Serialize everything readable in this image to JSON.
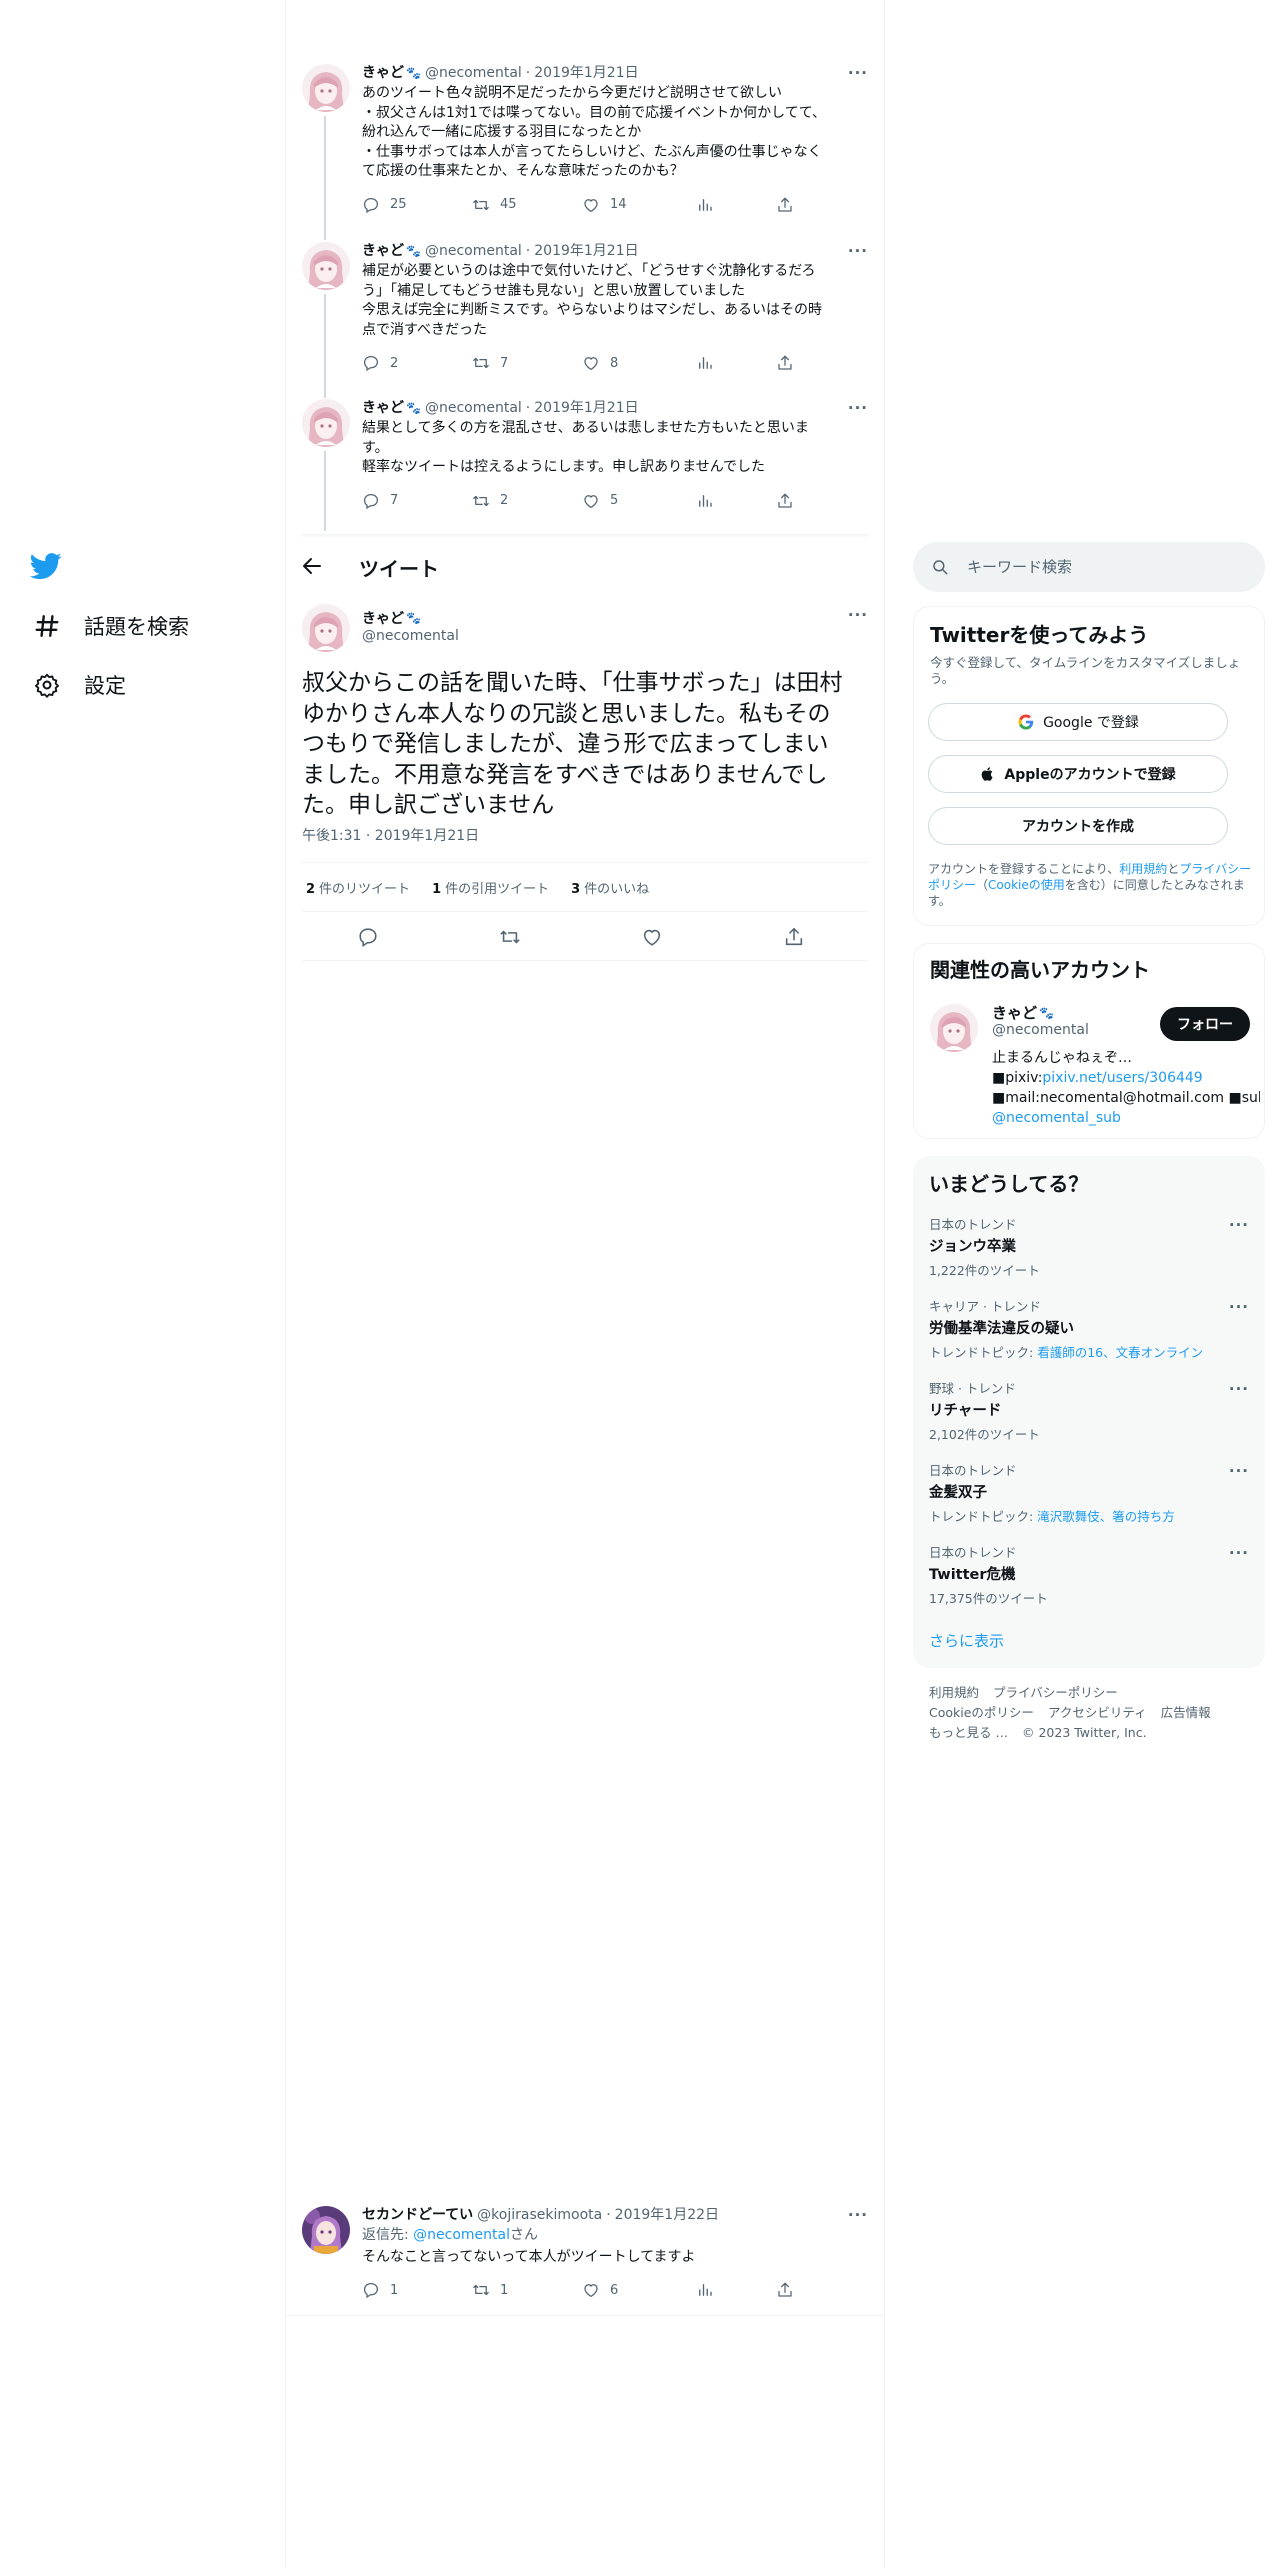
{
  "nav": {
    "items": [
      {
        "label": "話題を検索"
      },
      {
        "label": "設定"
      }
    ]
  },
  "thread": [
    {
      "name": "きゃど",
      "handle": "@necomental",
      "date": "2019年1月21日",
      "lines": [
        "あのツイート色々説明不足だったから今更だけど説明させて欲しい",
        "・叔父さんは1対1では喋ってない。目の前で応援イベントか何かしてて、",
        "紛れ込んで一緒に応援する羽目になったとか",
        "・仕事サボっては本人が言ってたらしいけど、たぶん声優の仕事じゃなく",
        "て応援の仕事来たとか、そんな意味だったのかも？"
      ],
      "replies": "25",
      "retweets": "45",
      "likes": "14"
    },
    {
      "name": "きゃど",
      "handle": "@necomental",
      "date": "2019年1月21日",
      "lines": [
        "補足が必要というのは途中で気付いたけど、「どうせすぐ沈静化するだろ",
        "う」「補足してもどうせ誰も見ない」と思い放置していました",
        "今思えば完全に判断ミスです。やらないよりはマシだし、あるいはその時",
        "点で消すべきだった"
      ],
      "replies": "2",
      "retweets": "7",
      "likes": "8"
    },
    {
      "name": "きゃど",
      "handle": "@necomental",
      "date": "2019年1月21日",
      "lines": [
        "結果として多くの方を混乱させ、あるいは悲しませた方もいたと思いま",
        "す。",
        "軽率なツイートは控えるようにします。申し訳ありませんでした"
      ],
      "replies": "7",
      "retweets": "2",
      "likes": "5"
    }
  ],
  "header": {
    "title": "ツイート"
  },
  "main_tweet": {
    "name": "きゃど",
    "handle": "@necomental",
    "lines": [
      "叔父からこの話を聞いた時、「仕事サボった」は田村",
      "ゆかりさん本人なりの冗談と思いました。私もその",
      "つもりで発信しましたが、違う形で広まってしまい",
      "ました。不用意な発言をすべきではありませんでし",
      "た。申し訳ございません"
    ],
    "time": "午後1:31 · 2019年1月21日",
    "stats": {
      "retweets_count": "2",
      "retweets_label": "件のリツイート",
      "quotes_count": "1",
      "quotes_label": "件の引用ツイート",
      "likes_count": "3",
      "likes_label": "件のいいね"
    }
  },
  "reply_tweet": {
    "name": "セカンドどーてい",
    "handle": "@kojirasekimoota",
    "date": "2019年1月22日",
    "reply_to_prefix": "返信先: ",
    "reply_to_handle": "@necomental",
    "reply_to_suffix": "さん",
    "text": "そんなこと言ってないって本人がツイートしてますよ",
    "replies": "1",
    "retweets": "1",
    "likes": "6"
  },
  "search": {
    "placeholder": "キーワード検索"
  },
  "signup": {
    "title": "Twitterを使ってみよう",
    "subtitle": "今すぐ登録して、タイムラインをカスタマイズしましょう。",
    "google_label": "Google で登録",
    "apple_label": "Appleのアカウントで登録",
    "create_label": "アカウントを作成",
    "legal_1": "アカウントを登録することにより、",
    "legal_terms": "利用規約",
    "legal_and": "と",
    "legal_privacy": "プライバシーポリシー",
    "legal_paren_open": "（",
    "legal_cookie": "Cookieの使用",
    "legal_2": "を含む）に同意したとみなされます。"
  },
  "related": {
    "title": "関連性の高いアカウント",
    "name": "きゃど",
    "handle": "@necomental",
    "follow_label": "フォロー",
    "bio_1": "止まるんじゃねぇぞ…",
    "bio_pixiv_prefix": "■pixiv:",
    "bio_pixiv_link": "pixiv.net/users/306449",
    "bio_mail": "■mail:necomental@hotmail.com ■sub:",
    "bio_sub_link": "@necomental_sub"
  },
  "trends": {
    "title": "いまどうしてる？",
    "items": [
      {
        "meta": "日本のトレンド",
        "name": "ジョンウ卒業",
        "sub": "1,222件のツイート",
        "sub_prefix": "",
        "sub_links": ""
      },
      {
        "meta": "キャリア · トレンド",
        "name": "労働基準法違反の疑い",
        "sub": "",
        "sub_prefix": "トレンドトピック: ",
        "sub_links": "看護師の16、文春オンライン"
      },
      {
        "meta": "野球 · トレンド",
        "name": "リチャード",
        "sub": "2,102件のツイート",
        "sub_prefix": "",
        "sub_links": ""
      },
      {
        "meta": "日本のトレンド",
        "name": "金髪双子",
        "sub": "",
        "sub_prefix": "トレンドトピック: ",
        "sub_links": "滝沢歌舞伎、箸の持ち方"
      },
      {
        "meta": "日本のトレンド",
        "name": "Twitter危機",
        "sub": "17,375件のツイート",
        "sub_prefix": "",
        "sub_links": ""
      }
    ],
    "show_more": "さらに表示"
  },
  "footer": {
    "terms": "利用規約",
    "privacy": "プライバシーポリシー",
    "cookie": "Cookieのポリシー",
    "accessibility": "アクセシビリティ",
    "ads": "広告情報",
    "more": "もっと見る …",
    "copyright": "© 2023 Twitter, Inc."
  },
  "colors": {
    "accent": "#1d9bf0",
    "text": "#0f1419",
    "muted": "#536471",
    "border": "#eff3f4"
  }
}
